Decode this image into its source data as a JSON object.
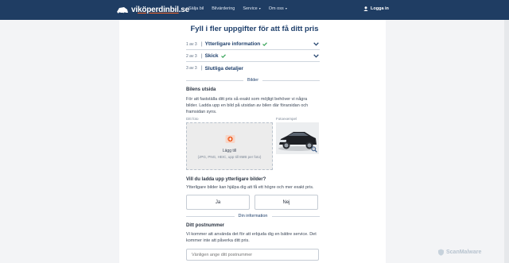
{
  "header": {
    "logo_prefix": "vi",
    "logo_main": "köperdinbil",
    "logo_suffix": ".se",
    "nav": [
      {
        "label": "Sälja bil"
      },
      {
        "label": "Bilvärdering"
      },
      {
        "label": "Service"
      },
      {
        "label": "Om oss"
      }
    ],
    "login_label": "Logga in"
  },
  "form": {
    "title": "Fyll i fler uppgifter för att få ditt pris",
    "steps": [
      {
        "num": "1 av 3",
        "label": "Ytterligare information",
        "done": true
      },
      {
        "num": "2 av 3",
        "label": "Skick",
        "done": true
      },
      {
        "num": "3 av 3",
        "label": "Slutliga detaljer",
        "done": false
      }
    ],
    "images_section": {
      "heading": "Bilder",
      "subheading": "Bilens utsida",
      "description": "För att fastställa ditt pris så exakt som möjligt behöver vi några bilder. Ladda upp en bild på utsidan av bilen där förarsidan och framsidan syns.",
      "your_photo_label": "Ditt foto",
      "example_label": "Fotoexempel",
      "upload_label": "Lägg till",
      "upload_hint": "(JPG, PNG, HEIC, upp till 8MB per foto)"
    },
    "more_images": {
      "question": "Vill du ladda upp ytterligare bilder?",
      "description": "Ytterligare bilder kan hjälpa dig att få ett högre och mer exakt pris.",
      "yes_label": "Ja",
      "no_label": "Nej"
    },
    "info_section": {
      "heading": "Din information",
      "subheading": "Ditt postnummer",
      "description": "Vi kommer att använda det för att erbjuda dig en bättre service. Det kommer inte att påverka ditt pris.",
      "postcode_placeholder": "Vänligen ange ditt postnummer"
    }
  },
  "watermark": "ScanMalware",
  "colors": {
    "navbar": "#1f3d63",
    "brand_text": "#1e3f6b",
    "accent_orange": "#f0642a",
    "check_green": "#3aa55b"
  }
}
